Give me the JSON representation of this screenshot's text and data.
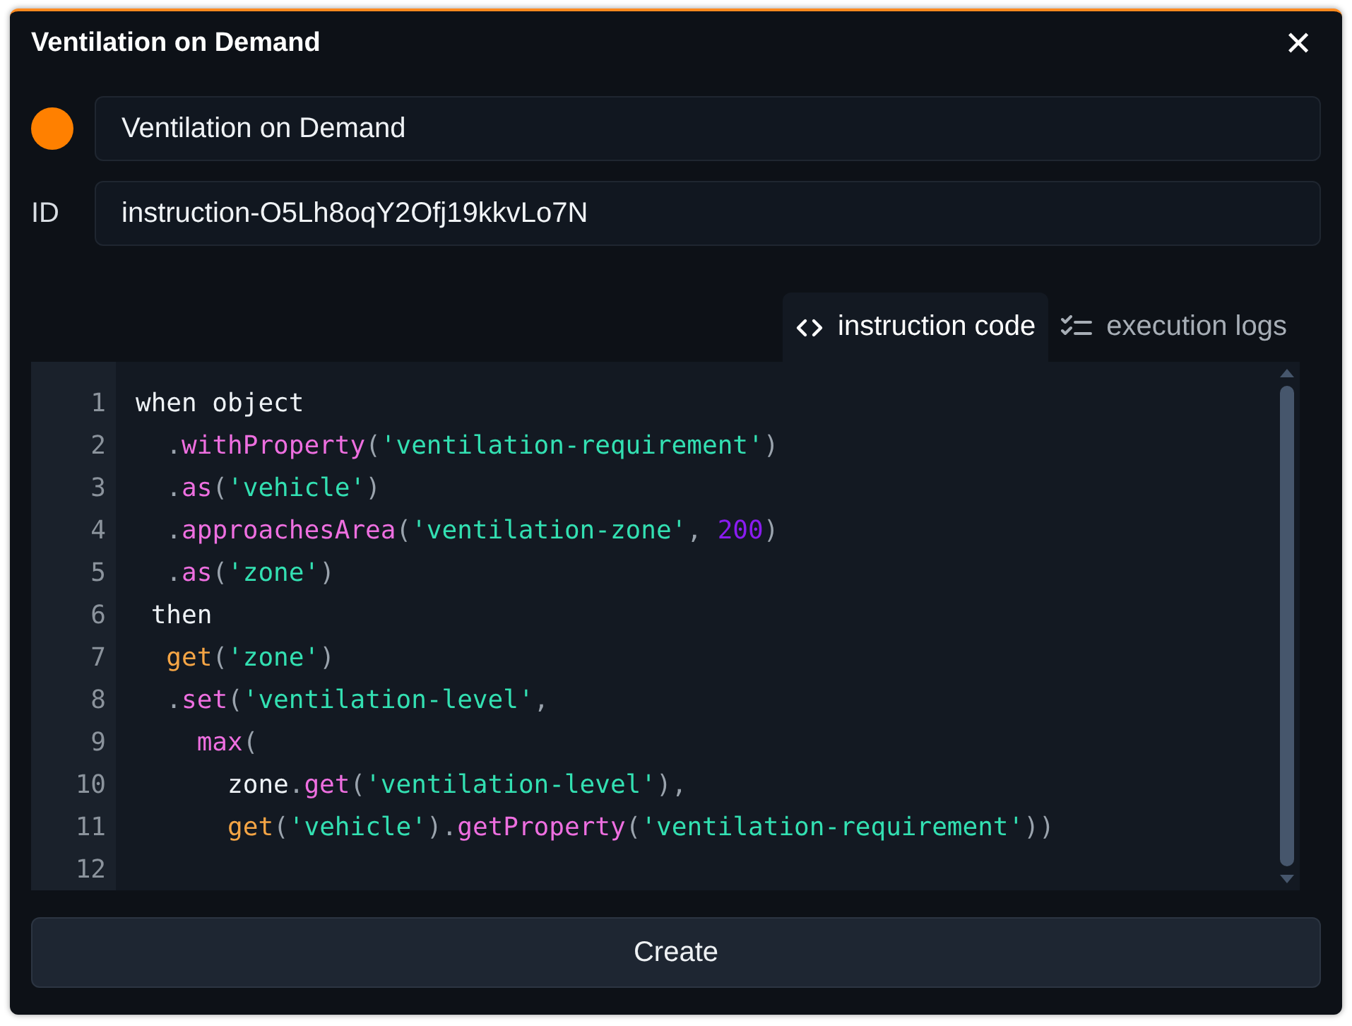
{
  "dialog": {
    "title": "Ventilation on Demand",
    "close": "✕"
  },
  "name_field": {
    "value": "Ventilation on Demand"
  },
  "id_field": {
    "label": "ID",
    "value": "instruction-O5Lh8oqY2Ofj19kkvLo7N"
  },
  "tabs": [
    {
      "label": "instruction code",
      "selected": true
    },
    {
      "label": "execution logs",
      "selected": false
    }
  ],
  "code": [
    {
      "number": "1",
      "tokens": [
        {
          "kind": "plain",
          "text": "when object"
        }
      ]
    },
    {
      "number": "2",
      "tokens": [
        {
          "kind": "member",
          "text": "  .withProperty"
        },
        {
          "kind": "punct",
          "text": "("
        },
        {
          "kind": "string",
          "text": "'ventilation-requirement'"
        },
        {
          "kind": "punct",
          "text": ")"
        }
      ]
    },
    {
      "number": "3",
      "tokens": [
        {
          "kind": "member",
          "text": "  .as"
        },
        {
          "kind": "punct",
          "text": "("
        },
        {
          "kind": "string",
          "text": "'vehicle'"
        },
        {
          "kind": "punct",
          "text": ")"
        }
      ]
    },
    {
      "number": "4",
      "tokens": [
        {
          "kind": "member",
          "text": "  .approachesArea"
        },
        {
          "kind": "punct",
          "text": "("
        },
        {
          "kind": "string",
          "text": "'ventilation-zone'"
        },
        {
          "kind": "punct",
          "text": ", "
        },
        {
          "kind": "number",
          "text": "200"
        },
        {
          "kind": "punct",
          "text": ")"
        }
      ]
    },
    {
      "number": "5",
      "tokens": [
        {
          "kind": "member",
          "text": "  .as"
        },
        {
          "kind": "punct",
          "text": "("
        },
        {
          "kind": "string",
          "text": "'zone'"
        },
        {
          "kind": "punct",
          "text": ")"
        }
      ]
    },
    {
      "number": "6",
      "tokens": [
        {
          "kind": "plain",
          "text": " then"
        }
      ]
    },
    {
      "number": "7",
      "tokens": [
        {
          "kind": "call",
          "text": "  get"
        },
        {
          "kind": "punct",
          "text": "("
        },
        {
          "kind": "string",
          "text": "'zone'"
        },
        {
          "kind": "punct",
          "text": ")"
        }
      ]
    },
    {
      "number": "8",
      "tokens": [
        {
          "kind": "member",
          "text": "  .set"
        },
        {
          "kind": "punct",
          "text": "("
        },
        {
          "kind": "string",
          "text": "'ventilation-level'"
        },
        {
          "kind": "punct",
          "text": ","
        }
      ]
    },
    {
      "number": "9",
      "tokens": [
        {
          "kind": "method",
          "text": "    max"
        },
        {
          "kind": "punct",
          "text": "("
        }
      ]
    },
    {
      "number": "10",
      "tokens": [
        {
          "kind": "plain",
          "text": "      zone"
        },
        {
          "kind": "member",
          "text": ".get"
        },
        {
          "kind": "punct",
          "text": "("
        },
        {
          "kind": "string",
          "text": "'ventilation-level'"
        },
        {
          "kind": "punct",
          "text": "),"
        }
      ]
    },
    {
      "number": "11",
      "tokens": [
        {
          "kind": "call",
          "text": "      get"
        },
        {
          "kind": "punct",
          "text": "("
        },
        {
          "kind": "string",
          "text": "'vehicle'"
        },
        {
          "kind": "punct",
          "text": ")"
        },
        {
          "kind": "member",
          "text": ".getProperty"
        },
        {
          "kind": "punct",
          "text": "("
        },
        {
          "kind": "string",
          "text": "'ventilation-requirement'"
        },
        {
          "kind": "punct",
          "text": "))"
        }
      ]
    },
    {
      "number": "12"
    }
  ],
  "create_button": {
    "label": "Create"
  }
}
